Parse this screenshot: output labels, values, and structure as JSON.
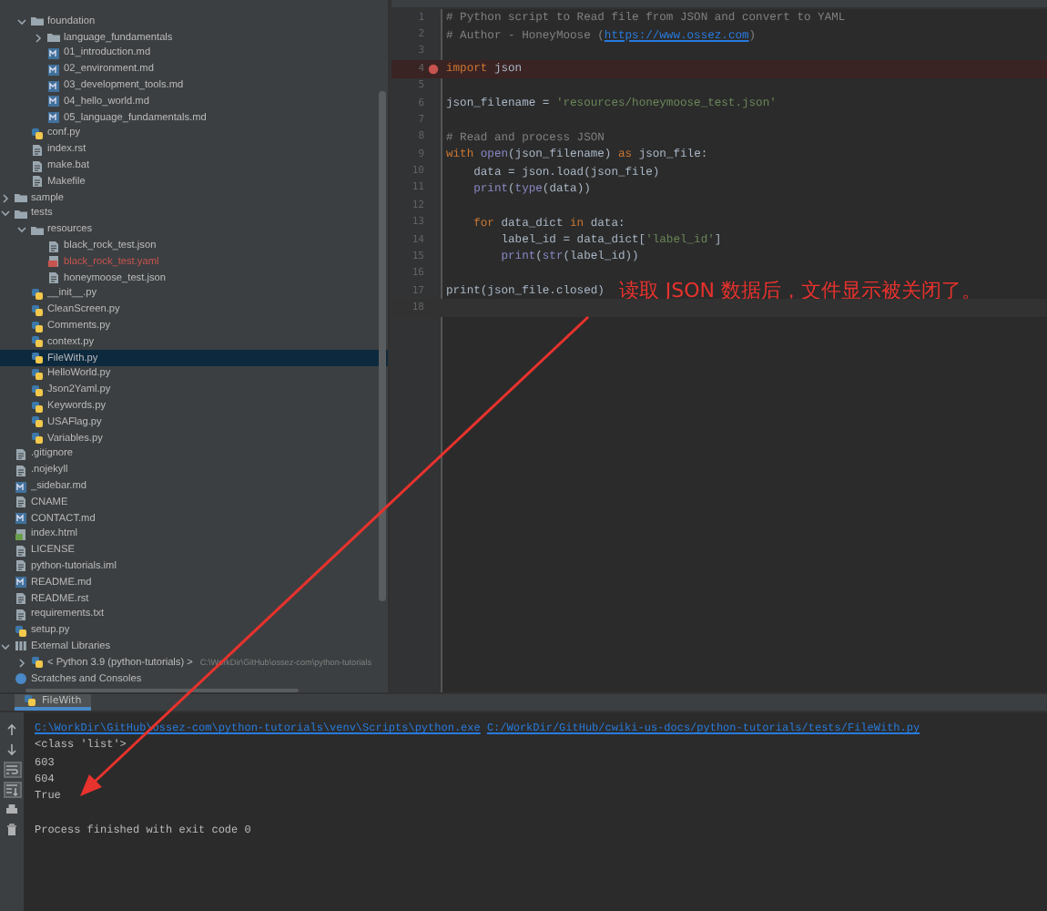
{
  "project_tree": [
    {
      "children": [
        {
          "label": "foundation",
          "kind": "folder",
          "expanded": true,
          "selected": false,
          "children": [
            {
              "label": "language_fundamentals",
              "kind": "folder",
              "expanded": false,
              "selected": false
            },
            {
              "label": "01_introduction.md",
              "kind": "markdown",
              "selected": false
            },
            {
              "label": "02_environment.md",
              "kind": "markdown",
              "selected": false
            },
            {
              "label": "03_development_tools.md",
              "kind": "markdown",
              "selected": false
            },
            {
              "label": "04_hello_world.md",
              "kind": "markdown",
              "selected": false
            },
            {
              "label": "05_language_fundamentals.md",
              "kind": "markdown",
              "selected": false
            }
          ]
        },
        {
          "label": "conf.py",
          "kind": "python",
          "selected": false
        },
        {
          "label": "index.rst",
          "kind": "text",
          "selected": false
        },
        {
          "label": "make.bat",
          "kind": "text",
          "selected": false
        },
        {
          "label": "Makefile",
          "kind": "text",
          "selected": false
        }
      ]
    },
    {
      "label": "sample",
      "kind": "folder",
      "expanded": false,
      "selected": false
    },
    {
      "label": "tests",
      "kind": "folder",
      "expanded": true,
      "selected": false,
      "children": [
        {
          "label": "resources",
          "kind": "folder",
          "expanded": true,
          "selected": false,
          "children": [
            {
              "label": "black_rock_test.json",
              "kind": "text",
              "selected": false
            },
            {
              "label": "black_rock_test.yaml",
              "kind": "yaml",
              "selected": false,
              "color": "#c75450"
            },
            {
              "label": "honeymoose_test.json",
              "kind": "text",
              "selected": false
            }
          ]
        },
        {
          "label": "__init__.py",
          "kind": "python",
          "selected": false
        },
        {
          "label": "CleanScreen.py",
          "kind": "python",
          "selected": false
        },
        {
          "label": "Comments.py",
          "kind": "python",
          "selected": false
        },
        {
          "label": "context.py",
          "kind": "python",
          "selected": false
        },
        {
          "label": "FileWith.py",
          "kind": "python",
          "selected": true
        },
        {
          "label": "HelloWorld.py",
          "kind": "python",
          "selected": false
        },
        {
          "label": "Json2Yaml.py",
          "kind": "python",
          "selected": false
        },
        {
          "label": "Keywords.py",
          "kind": "python",
          "selected": false
        },
        {
          "label": "USAFlag.py",
          "kind": "python",
          "selected": false
        },
        {
          "label": "Variables.py",
          "kind": "python",
          "selected": false
        }
      ]
    },
    {
      "label": ".gitignore",
      "kind": "text",
      "selected": false
    },
    {
      "label": ".nojekyll",
      "kind": "text",
      "selected": false
    },
    {
      "label": "_sidebar.md",
      "kind": "markdown",
      "selected": false
    },
    {
      "label": "CNAME",
      "kind": "text",
      "selected": false
    },
    {
      "label": "CONTACT.md",
      "kind": "markdown",
      "selected": false
    },
    {
      "label": "index.html",
      "kind": "html",
      "selected": false
    },
    {
      "label": "LICENSE",
      "kind": "text",
      "selected": false
    },
    {
      "label": "python-tutorials.iml",
      "kind": "text",
      "selected": false
    },
    {
      "label": "README.md",
      "kind": "markdown",
      "selected": false
    },
    {
      "label": "README.rst",
      "kind": "text",
      "selected": false
    },
    {
      "label": "requirements.txt",
      "kind": "text",
      "selected": false
    },
    {
      "label": "setup.py",
      "kind": "python",
      "selected": false
    },
    {
      "label": "External Libraries",
      "kind": "library",
      "expanded": true,
      "selected": false,
      "children": [
        {
          "label": "< Python 3.9 (python-tutorials) >",
          "kind": "python",
          "expanded": false,
          "selected": false,
          "detail": "C:\\WorkDir\\GitHub\\ossez-com\\python-tutorials"
        }
      ]
    },
    {
      "label": "Scratches and Consoles",
      "kind": "scratch",
      "selected": false
    }
  ],
  "editor": {
    "lines": [
      {
        "number": "1",
        "breakpoint": false,
        "current": false,
        "tokens": [
          {
            "kind": "comment",
            "text": "# Python script to Read file from JSON and convert to YAML"
          }
        ]
      },
      {
        "number": "2",
        "breakpoint": false,
        "current": false,
        "tokens": [
          {
            "kind": "comment",
            "text": "# Author - HoneyMoose ("
          },
          {
            "kind": "link",
            "text": "https://www.ossez.com"
          },
          {
            "kind": "comment",
            "text": ")"
          }
        ]
      },
      {
        "number": "3",
        "breakpoint": false,
        "current": false
      },
      {
        "number": "4",
        "breakpoint": true,
        "current": false,
        "tokens": [
          {
            "kind": "keyword",
            "text": "import"
          },
          {
            "kind": "plain",
            "text": " json"
          }
        ]
      },
      {
        "number": "5",
        "breakpoint": false,
        "current": false
      },
      {
        "number": "6",
        "breakpoint": false,
        "current": false,
        "tokens": [
          {
            "kind": "plain",
            "text": "json_filename = "
          },
          {
            "kind": "string",
            "text": "'resources/honeymoose_test.json'"
          }
        ]
      },
      {
        "number": "7",
        "breakpoint": false,
        "current": false
      },
      {
        "number": "8",
        "breakpoint": false,
        "current": false,
        "tokens": [
          {
            "kind": "comment",
            "text": "# Read and process JSON"
          }
        ]
      },
      {
        "number": "9",
        "breakpoint": false,
        "current": false,
        "tokens": [
          {
            "kind": "keyword",
            "text": "with "
          },
          {
            "kind": "builtin",
            "text": "open"
          },
          {
            "kind": "plain",
            "text": "(json_filename) "
          },
          {
            "kind": "keyword",
            "text": "as"
          },
          {
            "kind": "plain",
            "text": " json_file:"
          }
        ]
      },
      {
        "number": "10",
        "breakpoint": false,
        "current": false,
        "tokens": [
          {
            "kind": "plain",
            "text": "    data = json.load(json_file)"
          }
        ]
      },
      {
        "number": "11",
        "breakpoint": false,
        "current": false,
        "tokens": [
          {
            "kind": "builtin",
            "text": "    print"
          },
          {
            "kind": "plain",
            "text": "("
          },
          {
            "kind": "builtin",
            "text": "type"
          },
          {
            "kind": "plain",
            "text": "(data))"
          }
        ]
      },
      {
        "number": "12",
        "breakpoint": false,
        "current": false
      },
      {
        "number": "13",
        "breakpoint": false,
        "current": false,
        "tokens": [
          {
            "kind": "keyword",
            "text": "    for"
          },
          {
            "kind": "plain",
            "text": " data_dict "
          },
          {
            "kind": "keyword",
            "text": "in"
          },
          {
            "kind": "plain",
            "text": " data:"
          }
        ]
      },
      {
        "number": "14",
        "breakpoint": false,
        "current": false,
        "tokens": [
          {
            "kind": "plain",
            "text": "        label_id = data_dict["
          },
          {
            "kind": "string",
            "text": "'label_id'"
          },
          {
            "kind": "plain",
            "text": "]"
          }
        ]
      },
      {
        "number": "15",
        "breakpoint": false,
        "current": false,
        "tokens": [
          {
            "kind": "builtin",
            "text": "        print"
          },
          {
            "kind": "plain",
            "text": "("
          },
          {
            "kind": "builtin",
            "text": "str"
          },
          {
            "kind": "plain",
            "text": "(label_id))"
          }
        ]
      },
      {
        "number": "16",
        "breakpoint": false,
        "current": false
      },
      {
        "number": "17",
        "breakpoint": false,
        "current": false,
        "tokens": [
          {
            "kind": "plain",
            "text": "print(json_file.closed)"
          }
        ],
        "note": "读取 JSON 数据后，文件显示被关闭了。"
      },
      {
        "number": "18",
        "breakpoint": false,
        "current": true
      }
    ]
  },
  "run_panel": {
    "tab": "FileWith",
    "toolbar": [
      {
        "kind": "up",
        "selected": false
      },
      {
        "kind": "down",
        "selected": false
      },
      {
        "kind": "wrap",
        "selected": true
      },
      {
        "kind": "scroll",
        "selected": true
      },
      {
        "kind": "print",
        "selected": false
      },
      {
        "kind": "trash",
        "selected": false
      }
    ],
    "output": [
      {
        "kind": "command",
        "parts": [
          {
            "kind": "link",
            "text": "C:\\WorkDir\\GitHub\\ossez-com\\python-tutorials\\venv\\Scripts\\python.exe"
          },
          {
            "kind": "link",
            "text": "C:/WorkDir/GitHub/cwiki-us-docs/python-tutorials/tests/FileWith.py"
          }
        ]
      },
      {
        "kind": "output",
        "parts": [
          {
            "kind": "plain",
            "text": "<class 'list'>"
          }
        ]
      },
      {
        "kind": "output",
        "parts": [
          {
            "kind": "plain",
            "text": "603"
          }
        ]
      },
      {
        "kind": "output",
        "parts": [
          {
            "kind": "plain",
            "text": "604"
          }
        ]
      },
      {
        "kind": "output",
        "parts": [
          {
            "kind": "plain",
            "text": "True"
          }
        ]
      },
      {
        "kind": "status",
        "parts": [
          {
            "kind": "plain",
            "text": "Process finished with exit code 0"
          }
        ]
      }
    ]
  }
}
